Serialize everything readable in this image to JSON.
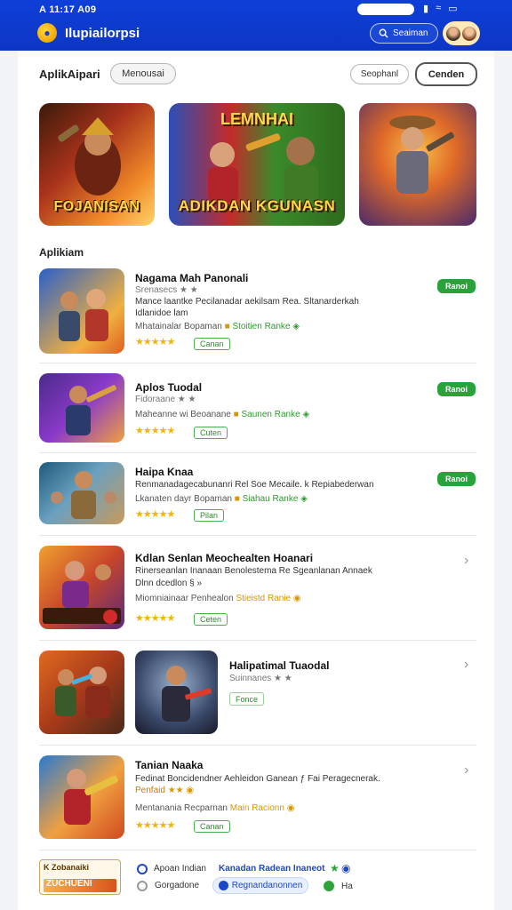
{
  "status_bar": {
    "time": "A 11:17 A09"
  },
  "header": {
    "title": "Ilupiailorpsi",
    "search_label": "Seaiman"
  },
  "section1": {
    "title": "AplikAipari",
    "filter": "Menousai",
    "right_pill_1": "Seophanl",
    "right_pill_2": "Cenden"
  },
  "banners": [
    {
      "bottom_text": "FOJANISAN",
      "top_text": ""
    },
    {
      "bottom_text": "ADIKDAN KGUNASN",
      "top_text": "LEMNHAI"
    },
    {
      "bottom_text": "",
      "top_text": ""
    }
  ],
  "section2": {
    "title": "Aplikiam"
  },
  "apps": [
    {
      "name": "Nagama Mah Panonali",
      "sub": "Srenasecs ★ ★",
      "desc1": "Mance laantke Pecilanadar aekilsam Rea. Sltanarderkah",
      "desc2": "Idlanidoe lam",
      "meta_a": "Mhatainalar Bopaman",
      "meta_b": "Stoitien Ranke",
      "tag": "Canan",
      "button": "Ranoi"
    },
    {
      "name": "Aplos Tuodal",
      "sub": "Fidoraane ★ ★",
      "desc1": "",
      "desc2": "",
      "meta_a": "Maheanne wi Beoanane",
      "meta_b": "Saunen Ranke",
      "tag": "Cuten",
      "button": "Ranoi"
    },
    {
      "name": "Haipa Knaa",
      "sub": "",
      "desc1": "Renmanadagecabunanri Rel Soe Mecaile. k Repiabederwan",
      "desc2": "",
      "meta_a": "Lkanaten dayr Bopaman",
      "meta_b": "Siahau Ranke",
      "tag": "Pilan",
      "button": "Ranoi"
    },
    {
      "name": "Kdlan Senlan Meochealten Hoanari",
      "sub": "",
      "desc1": "Rinerseanlan Inanaan Benolestema Re Sgeanlanan Annaek",
      "desc2": "Dlnn dcedlon § »",
      "meta_a": "Miomniainaar Penhealon",
      "meta_b": "Stieistd Ranie",
      "tag": "Ceten",
      "button": ""
    },
    {
      "name": "Halipatimal Tuaodal",
      "sub": "Suinnanes ★ ★",
      "desc1": "",
      "desc2": "",
      "meta_a": "",
      "meta_b": "",
      "tag": "Fonce",
      "button": ""
    },
    {
      "name": "Tanian Naaka",
      "sub": "",
      "desc1": "Fedinat Boncidendner Aehleidon Ganean ƒ Fai Peragecnerak.",
      "desc2": "Penfaid",
      "meta_a": "Mentanania Recparnan",
      "meta_b": "Main Racionn",
      "tag": "Canan",
      "button": ""
    }
  ],
  "footer": {
    "badge_line1": "K Zobanaiki",
    "badge_line2": "ZUCHUENI",
    "line1_text": "Apoan Indian",
    "line1_blue": "Kanadan Radean Inaneot",
    "line2_text": "Gorgadone",
    "line2_pill": "Regnandanonnen",
    "line2_end": "Ha"
  }
}
